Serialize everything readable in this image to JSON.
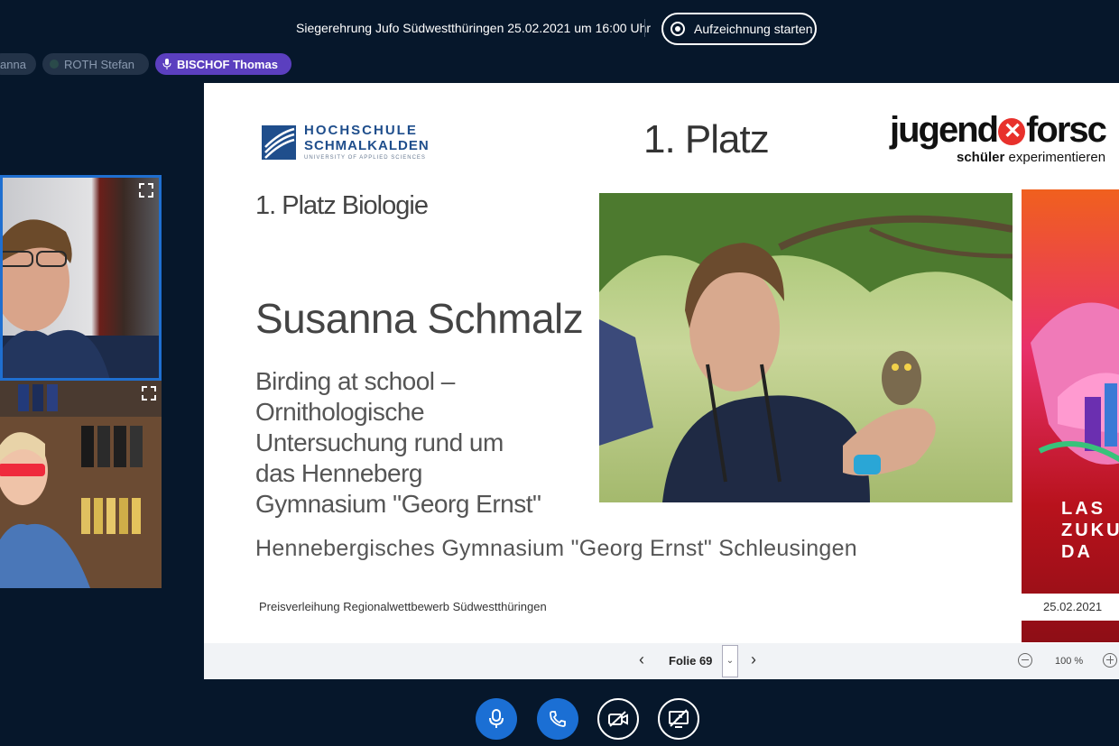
{
  "meeting": {
    "title": "Siegerehrung Jufo Südwestthüringen 25.02.2021 um 16:00 Uhr",
    "record_label": "Aufzeichnung starten"
  },
  "participants": [
    {
      "name": "anna"
    },
    {
      "name": "ROTH Stefan"
    },
    {
      "name": "BISCHOF Thomas",
      "speaking": true
    }
  ],
  "slide": {
    "university_line1": "HOCHSCHULE",
    "university_line2": "SCHMALKALDEN",
    "university_line3": "UNIVERSITY OF APPLIED SCIENCES",
    "place": "1. Platz",
    "brand_part1": "jugend",
    "brand_part2": "forsc",
    "brand_sub_bold": "schüler",
    "brand_sub_rest": " experimentieren",
    "category": "1. Platz Biologie",
    "name": "Susanna Schmalz",
    "project_lines": [
      "Birding at school –",
      "Ornithologische",
      "Untersuchung rund um",
      "das Henneberg",
      "Gymnasium \"Georg Ernst\""
    ],
    "school": "Hennebergisches Gymnasium \"Georg Ernst\" Schleusingen",
    "footer": "Preisverleihung Regionalwettbewerb Südwestthüringen",
    "poster_text": "LAS\nZUKU\nDA",
    "poster_date": "25.02.2021"
  },
  "slide_nav": {
    "slide_label": "Folie 69",
    "zoom": "100 %"
  },
  "controls": [
    "microphone",
    "phone",
    "camera-off",
    "screenshare-off"
  ]
}
